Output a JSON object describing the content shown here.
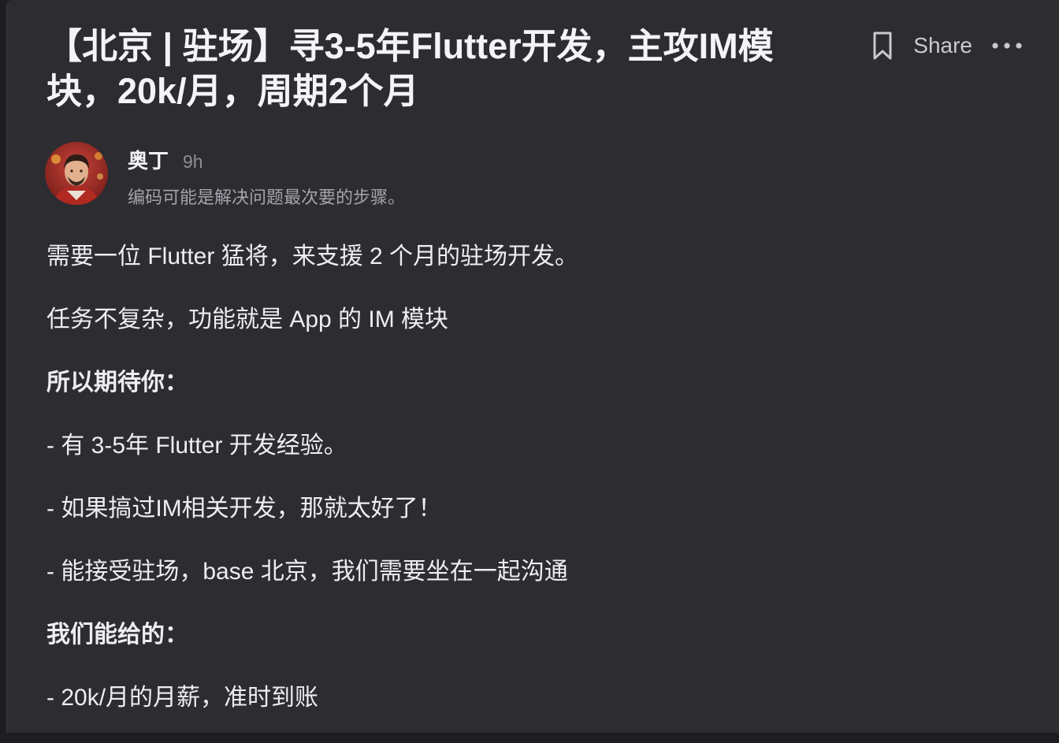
{
  "post": {
    "title": "【北京 | 驻场】寻3-5年Flutter开发，主攻IM模块，20k/月，周期2个月"
  },
  "actions": {
    "bookmark_icon": "bookmark-icon",
    "share_label": "Share",
    "more_icon": "more-icon"
  },
  "author": {
    "name": "奥丁",
    "time": "9h",
    "bio": "编码可能是解决问题最次要的步骤。"
  },
  "body": {
    "paragraphs": [
      {
        "text": "需要一位 Flutter 猛将，来支援 2 个月的驻场开发。",
        "bold": false
      },
      {
        "text": "任务不复杂，功能就是 App 的 IM 模块",
        "bold": false
      },
      {
        "text": "所以期待你：",
        "bold": true
      },
      {
        "text": "- 有 3-5年 Flutter 开发经验。",
        "bold": false
      },
      {
        "text": "- 如果搞过IM相关开发，那就太好了！",
        "bold": false
      },
      {
        "text": "- 能接受驻场，base 北京，我们需要坐在一起沟通",
        "bold": false
      },
      {
        "text": "我们能给的：",
        "bold": true
      },
      {
        "text": "- 20k/月的月薪，准时到账",
        "bold": false
      }
    ]
  },
  "colors": {
    "background": "#2c2c31",
    "text": "#eeeef1",
    "muted": "#8e8e96"
  }
}
